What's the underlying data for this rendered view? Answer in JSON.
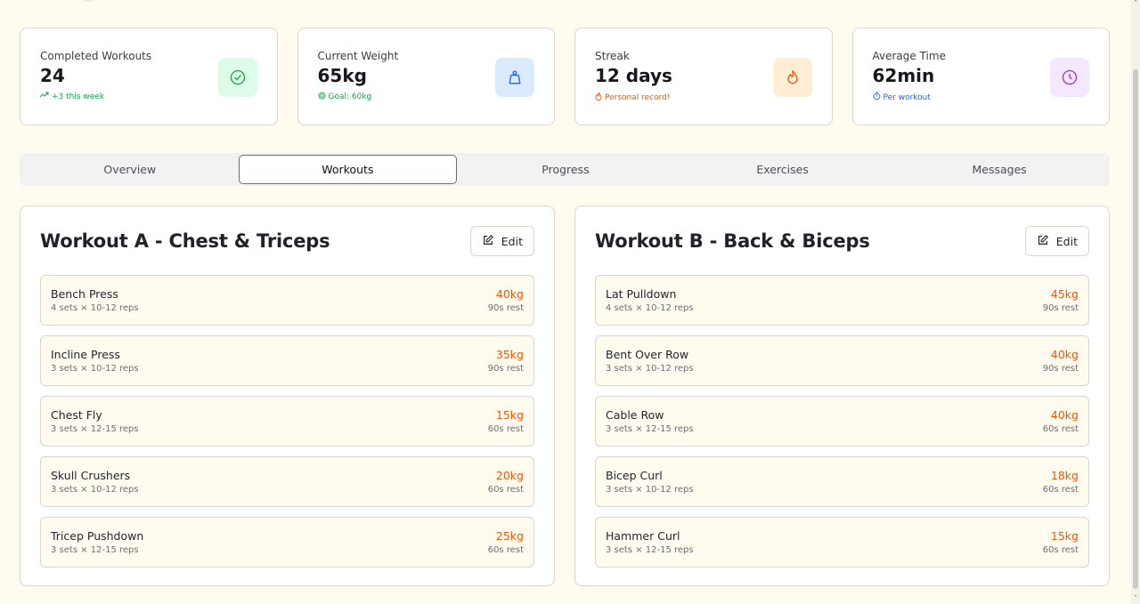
{
  "stats": [
    {
      "title": "Completed Workouts",
      "value": "24",
      "sub": "+3 this week",
      "sub_color": "#16a34a",
      "icon": "check-circle-icon",
      "icon_bg": "#dcfce7",
      "icon_color": "#16a34a",
      "sub_icon": "trending-up-icon"
    },
    {
      "title": "Current Weight",
      "value": "65kg",
      "sub": "Goal: 60kg",
      "sub_color": "#16a34a",
      "icon": "weight-icon",
      "icon_bg": "#dbeafe",
      "icon_color": "#2563eb",
      "sub_icon": "target-icon"
    },
    {
      "title": "Streak",
      "value": "12 days",
      "sub": "Personal record!",
      "sub_color": "#ea580c",
      "icon": "flame-icon",
      "icon_bg": "#ffedd5",
      "icon_color": "#ea580c",
      "sub_icon": "flame-icon"
    },
    {
      "title": "Average Time",
      "value": "62min",
      "sub": "Per workout",
      "sub_color": "#2563eb",
      "icon": "clock-icon",
      "icon_bg": "#f3e8ff",
      "icon_color": "#9333ea",
      "sub_icon": "timer-icon"
    }
  ],
  "tabs": [
    "Overview",
    "Workouts",
    "Progress",
    "Exercises",
    "Messages"
  ],
  "active_tab": "Workouts",
  "workouts": [
    {
      "title": "Workout A - Chest & Triceps",
      "edit_label": "Edit",
      "exercises": [
        {
          "name": "Bench Press",
          "sets": "4 sets × 10-12 reps",
          "weight": "40kg",
          "rest": "90s rest"
        },
        {
          "name": "Incline Press",
          "sets": "3 sets × 10-12 reps",
          "weight": "35kg",
          "rest": "90s rest"
        },
        {
          "name": "Chest Fly",
          "sets": "3 sets × 12-15 reps",
          "weight": "15kg",
          "rest": "60s rest"
        },
        {
          "name": "Skull Crushers",
          "sets": "3 sets × 10-12 reps",
          "weight": "20kg",
          "rest": "60s rest"
        },
        {
          "name": "Tricep Pushdown",
          "sets": "3 sets × 12-15 reps",
          "weight": "25kg",
          "rest": "60s rest"
        }
      ]
    },
    {
      "title": "Workout B - Back & Biceps",
      "edit_label": "Edit",
      "exercises": [
        {
          "name": "Lat Pulldown",
          "sets": "4 sets × 10-12 reps",
          "weight": "45kg",
          "rest": "90s rest"
        },
        {
          "name": "Bent Over Row",
          "sets": "3 sets × 10-12 reps",
          "weight": "40kg",
          "rest": "90s rest"
        },
        {
          "name": "Cable Row",
          "sets": "3 sets × 12-15 reps",
          "weight": "40kg",
          "rest": "60s rest"
        },
        {
          "name": "Bicep Curl",
          "sets": "3 sets × 10-12 reps",
          "weight": "18kg",
          "rest": "60s rest"
        },
        {
          "name": "Hammer Curl",
          "sets": "3 sets × 12-15 reps",
          "weight": "15kg",
          "rest": "60s rest"
        }
      ]
    }
  ]
}
